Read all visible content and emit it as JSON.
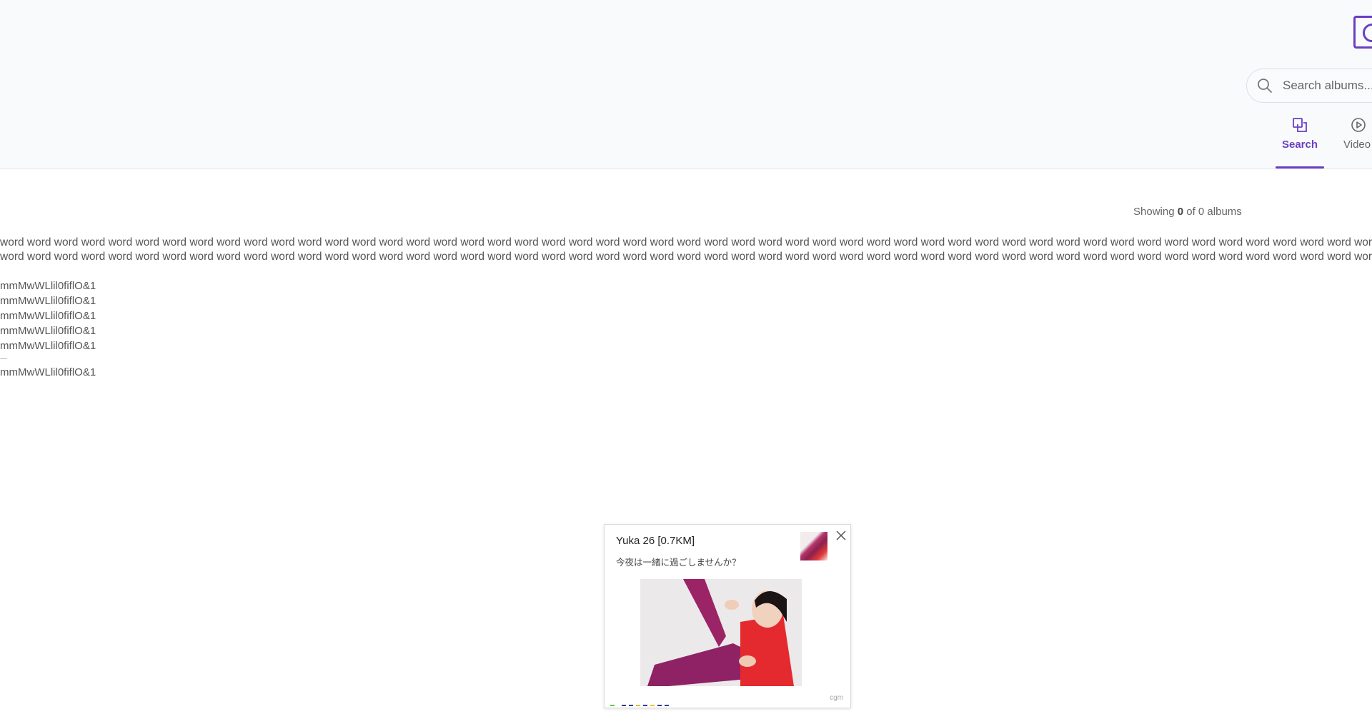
{
  "header": {
    "search": {
      "placeholder": "Search albums...."
    },
    "tabs": [
      {
        "label": "Search",
        "icon": "search-tab-icon",
        "active": true
      },
      {
        "label": "Video",
        "icon": "play-circle-icon",
        "active": false
      }
    ],
    "accent": "#6a3fc4"
  },
  "main": {
    "showing": {
      "prefix": "Showing ",
      "count": "0",
      "middle": " of ",
      "total": "0",
      "suffix": " albums"
    },
    "word_line_1": "word word word word word word word word word word word word word word word word word word word word word word word word word word word word word word word word word word word word word word word word word word word word word word word word word word word word word word word word word word word word word word",
    "word_line_2": "word word word word word word word word word word word word word word word word word word word word word word word word word word word word word word word word word word word word word word word word word word word word word word word word word word word word word word word word word word word word word",
    "lines": [
      "mmMwWLlil0fiflO&1",
      "mmMwWLlil0fiflO&1",
      "mmMwWLlil0fiflO&1",
      "mmMwWLlil0fiflO&1",
      "mmMwWLlil0fiflO&1"
    ],
    "dash": "—",
    "last_line": "mmMwWLlil0fiflO&1"
  },
  "popup": {
    "title": "Yuka 26 [0.7KM]",
    "text": "今夜は一緒に過ごしませんか？",
    "footer": "cgm"
  }
}
